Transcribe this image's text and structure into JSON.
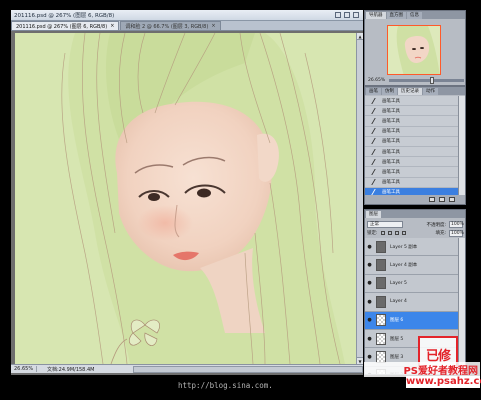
{
  "document": {
    "title": "201116.psd @ 267% (图层 6, RGB/8)",
    "tabs": [
      {
        "label": "201116.psd @ 267% (图层 6, RGB/8)",
        "active": true
      },
      {
        "label": "调和脸 2 @ 66.7% (图层 3, RGB/8)",
        "active": false
      }
    ],
    "close_glyph": "×",
    "zoom": "26.65%",
    "doc_info": "文档:24.9M/158.4M"
  },
  "navigator": {
    "tabs": [
      "导航器",
      "直方图",
      "信息"
    ],
    "zoom": "26.65%"
  },
  "history": {
    "tabs": [
      "画笔",
      "仿制",
      "历史记录",
      "动作"
    ],
    "items": [
      "画笔工具",
      "画笔工具",
      "画笔工具",
      "画笔工具",
      "画笔工具",
      "画笔工具",
      "画笔工具",
      "画笔工具",
      "画笔工具",
      "画笔工具"
    ],
    "selected_index": 9
  },
  "layers": {
    "tabs": [
      "图层"
    ],
    "blend_mode": "正常",
    "opacity_label": "不透明度:",
    "opacity": "100%",
    "lock_label": "锁定:",
    "fill_label": "填充:",
    "fill": "100%",
    "eye_glyph": "●",
    "items": [
      {
        "name": "Layer 5 副本",
        "thumb": "dark"
      },
      {
        "name": "Layer 4 副本",
        "thumb": "dark"
      },
      {
        "name": "Layer 5",
        "thumb": "dark"
      },
      {
        "name": "Layer 4",
        "thumb": "dark"
      },
      {
        "name": "图层 6",
        "thumb": "chk",
        "selected": true
      },
      {
        "name": "图层 5",
        "thumb": "chk"
      },
      {
        "name": "图层 3",
        "thumb": "chk"
      },
      {
        "name": "图层 2",
        "thumb": "chk"
      }
    ]
  },
  "watermark": {
    "seal": "已修",
    "name": "PS爱好者教程网",
    "site": "www.psahz.com",
    "blog": "http://blog.sina.com."
  },
  "colors": {
    "canvas_bg": "#d7e6b1",
    "selection": "#3c86ea",
    "watermark_red": "#e3232a"
  }
}
